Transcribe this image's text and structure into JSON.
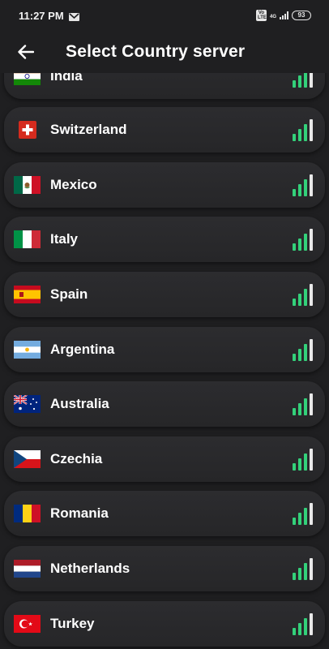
{
  "status": {
    "time": "11:27 PM",
    "network_badge": "Vo LTE",
    "network_type": "4G",
    "battery": "93"
  },
  "header": {
    "title": "Select Country server"
  },
  "servers": [
    {
      "name": "India",
      "flag": "india-flag-icon"
    },
    {
      "name": "Switzerland",
      "flag": "switzerland-flag-icon"
    },
    {
      "name": "Mexico",
      "flag": "mexico-flag-icon"
    },
    {
      "name": "Italy",
      "flag": "italy-flag-icon"
    },
    {
      "name": "Spain",
      "flag": "spain-flag-icon"
    },
    {
      "name": "Argentina",
      "flag": "argentina-flag-icon"
    },
    {
      "name": "Australia",
      "flag": "australia-flag-icon"
    },
    {
      "name": "Czechia",
      "flag": "czechia-flag-icon"
    },
    {
      "name": "Romania",
      "flag": "romania-flag-icon"
    },
    {
      "name": "Netherlands",
      "flag": "netherlands-flag-icon"
    },
    {
      "name": "Turkey",
      "flag": "turkey-flag-icon"
    }
  ],
  "colors": {
    "background": "#1f1f21",
    "signal_green": "#33d17a",
    "signal_white": "#e8e8e8"
  }
}
